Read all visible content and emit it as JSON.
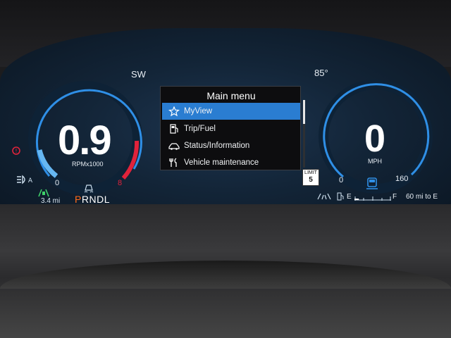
{
  "top_status": {
    "compass": "SW",
    "outside_temperature": "85°"
  },
  "tachometer": {
    "value": "0.9",
    "unit": "RPMx1000",
    "scale_min": "0",
    "scale_max": "8"
  },
  "speedometer": {
    "value": "0",
    "unit": "MPH",
    "scale_min": "0",
    "scale_max": "160"
  },
  "main_menu": {
    "title": "Main menu",
    "items": [
      {
        "label": "MyView",
        "icon": "star-icon",
        "selected": true
      },
      {
        "label": "Trip/Fuel",
        "icon": "fuel-pump-icon",
        "selected": false
      },
      {
        "label": "Status/Information",
        "icon": "car-icon",
        "selected": false
      },
      {
        "label": "Vehicle maintenance",
        "icon": "wrench-icon",
        "selected": false
      }
    ]
  },
  "speed_limit": {
    "label": "LIMIT",
    "value": "5"
  },
  "drivetrain": {
    "gears": [
      "P",
      "R",
      "N",
      "D",
      "L"
    ],
    "active_gear": "P",
    "trip_distance": "3.4 mi"
  },
  "fuel": {
    "empty_label": "E",
    "full_label": "F",
    "range": "60 mi to E",
    "level": 0.12
  },
  "colors": {
    "accent_blue": "#2a7dd1",
    "redline": "#e0233b",
    "gauge_arc": "#2f8fe6",
    "active_gear": "#ff6a1a"
  }
}
